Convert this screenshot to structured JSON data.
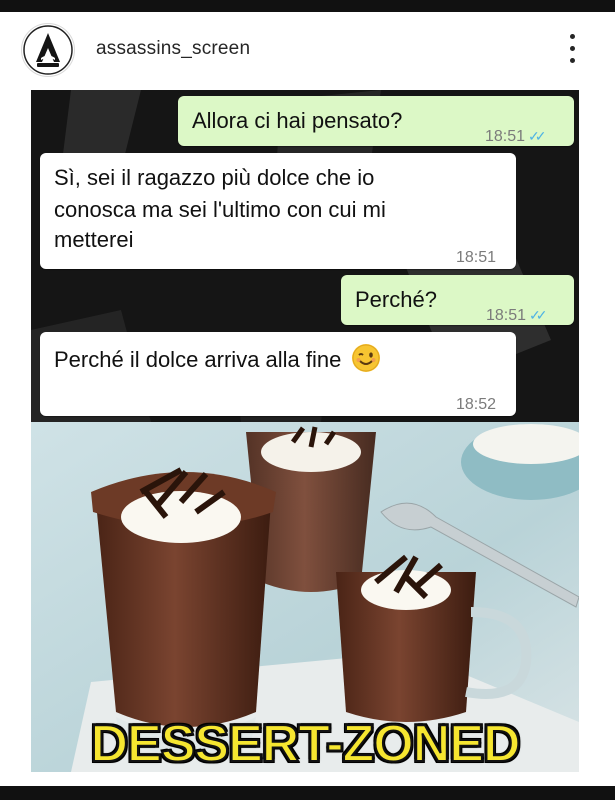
{
  "header": {
    "username": "assassins_screen",
    "avatar_icon": "assassins-creed-logo-icon",
    "menu_icon": "more-vertical-icon"
  },
  "chat": {
    "messages": [
      {
        "direction": "outgoing",
        "text": "Allora ci hai pensato?",
        "time": "18:51",
        "status": "read"
      },
      {
        "direction": "incoming",
        "lines": [
          "Sì, sei il ragazzo più dolce che io",
          "conosca ma sei l'ultimo con cui mi",
          "metterei"
        ],
        "time": "18:51"
      },
      {
        "direction": "outgoing",
        "text": "Perché?",
        "time": "18:51",
        "status": "read"
      },
      {
        "direction": "incoming",
        "text": "Perché il dolce arriva alla fine",
        "emoji": "winking-face-icon",
        "time": "18:52"
      }
    ],
    "ticks": "✓✓"
  },
  "photo": {
    "caption": "DESSERT-ZONED"
  },
  "colors": {
    "outgoing_bubble": "#dcf8c6",
    "incoming_bubble": "#ffffff",
    "read_ticks": "#4fb4e4",
    "caption": "#f6e630"
  }
}
